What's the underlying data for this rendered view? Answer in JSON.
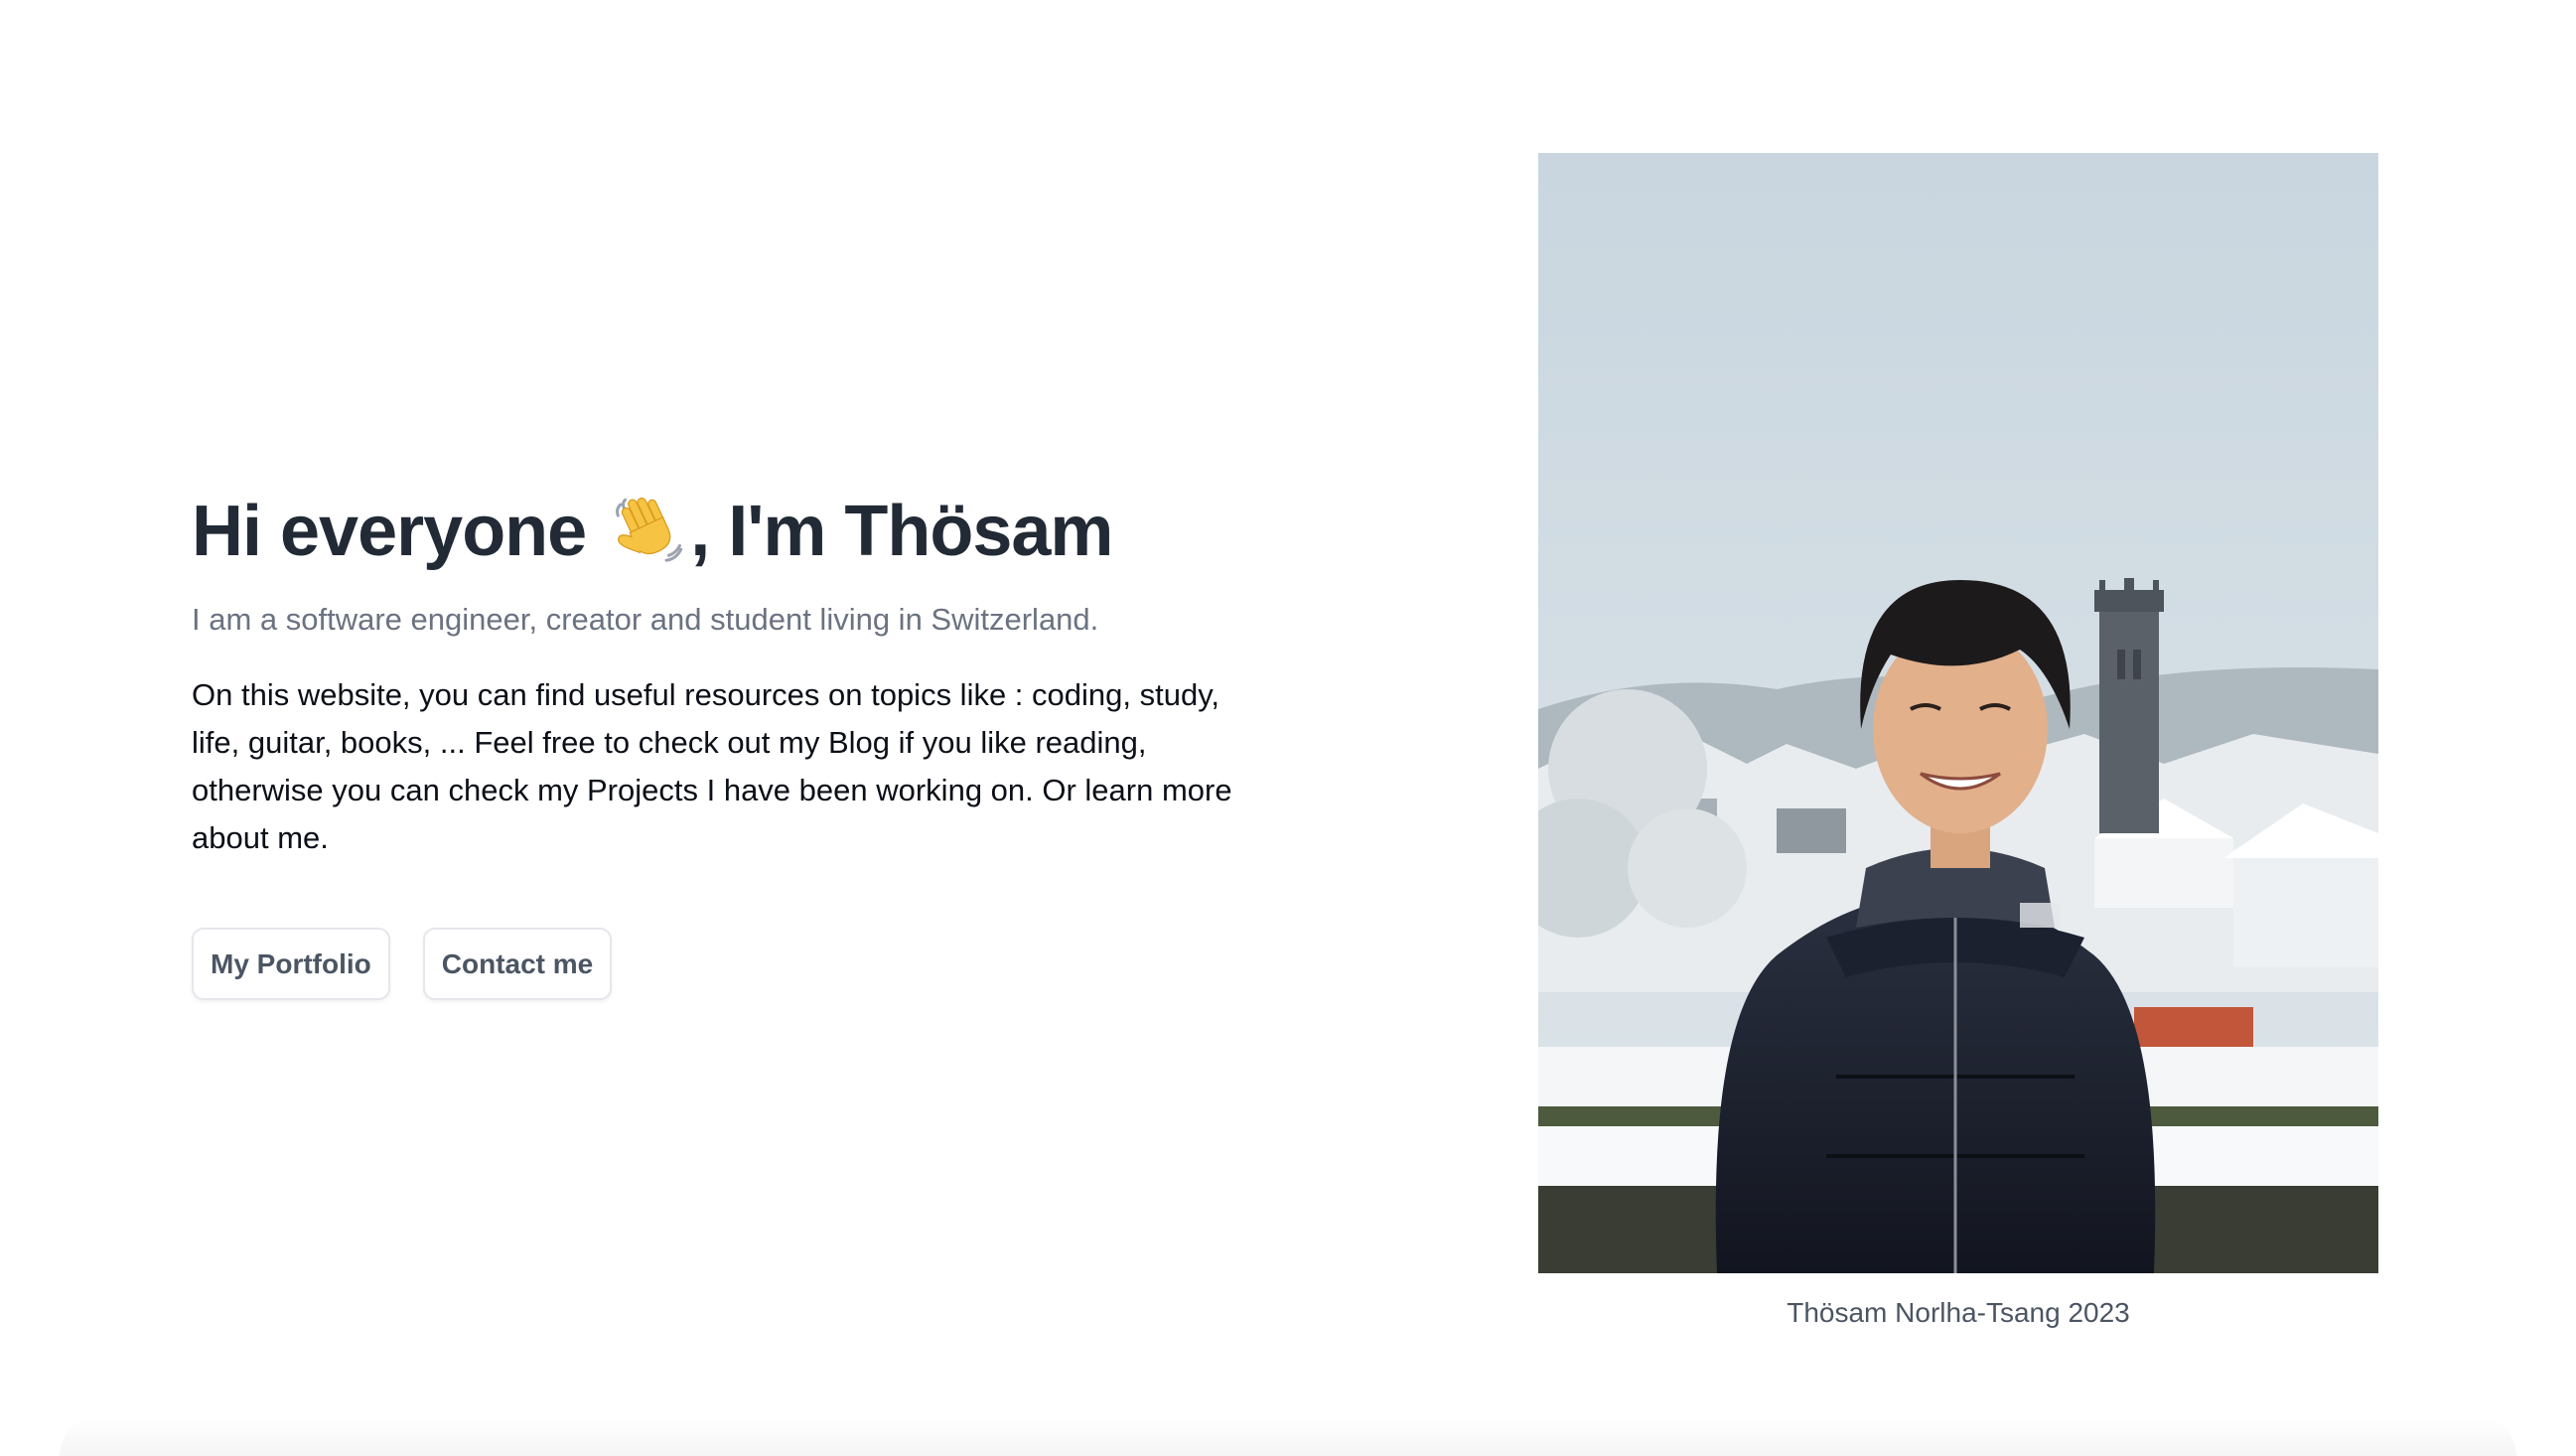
{
  "hero": {
    "greeting": "Hi everyone",
    "emoji_icon": "waving-hand-icon",
    "name_part": ", I'm Thösam",
    "subtitle": "I am a software engineer, creator and student living in Switzerland.",
    "description": "On this website, you can find useful resources on topics like : coding, study, life, guitar, books, ... Feel free to check out my Blog if you like reading, otherwise you can check my Projects I have been working on. Or learn more about me."
  },
  "actions": {
    "portfolio_label": "My Portfolio",
    "contact_label": "Contact me"
  },
  "photo": {
    "caption": "Thösam Norlha-Tsang 2023"
  },
  "colors": {
    "heading": "#222a36",
    "muted": "#6b7280",
    "body": "#0b0f17",
    "button_border": "#e5e7eb"
  }
}
